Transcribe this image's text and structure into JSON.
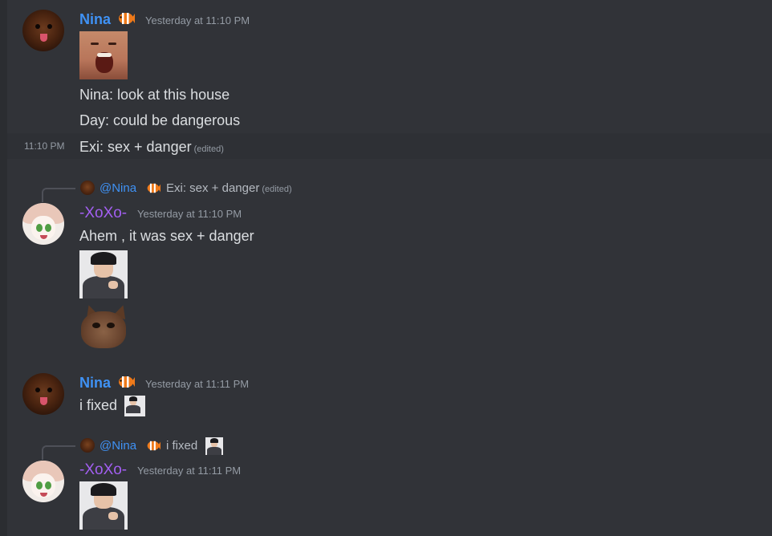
{
  "colors": {
    "background": "#313338",
    "nina_name": "#3f92f5",
    "xoxo_name": "#a35ff2",
    "text": "#dbdee1",
    "muted": "#949ba4"
  },
  "messages": [
    {
      "author": "Nina",
      "badge_icon": "clownfish-icon",
      "timestamp": "Yesterday at 11:10 PM",
      "sticker": "screaming-face-sticker",
      "lines": [
        "Nina:  look at this house",
        "Day: could be dangerous"
      ]
    },
    {
      "hover_time": "11:10 PM",
      "text": "Exi: sex + danger",
      "edited": "(edited)"
    },
    {
      "reply": {
        "mention": "@Nina",
        "badge_icon": "clownfish-icon",
        "text": "Exi: sex + danger",
        "edited": "(edited)"
      },
      "author": "-XoXo-",
      "timestamp": "Yesterday at 11:10 PM",
      "text": "Ahem , it was sex + danger",
      "stickers": [
        "man-pointing-sticker",
        "cat-face-sticker"
      ]
    },
    {
      "author": "Nina",
      "badge_icon": "clownfish-icon",
      "timestamp": "Yesterday at 11:11 PM",
      "text": "i fixed",
      "inline_sticker": "man-pointing-sticker"
    },
    {
      "reply": {
        "mention": "@Nina",
        "badge_icon": "clownfish-icon",
        "text": "i fixed",
        "inline_sticker": "man-pointing-sticker"
      },
      "author": "-XoXo-",
      "timestamp": "Yesterday at 11:11 PM",
      "sticker": "man-pointing-sticker"
    }
  ]
}
